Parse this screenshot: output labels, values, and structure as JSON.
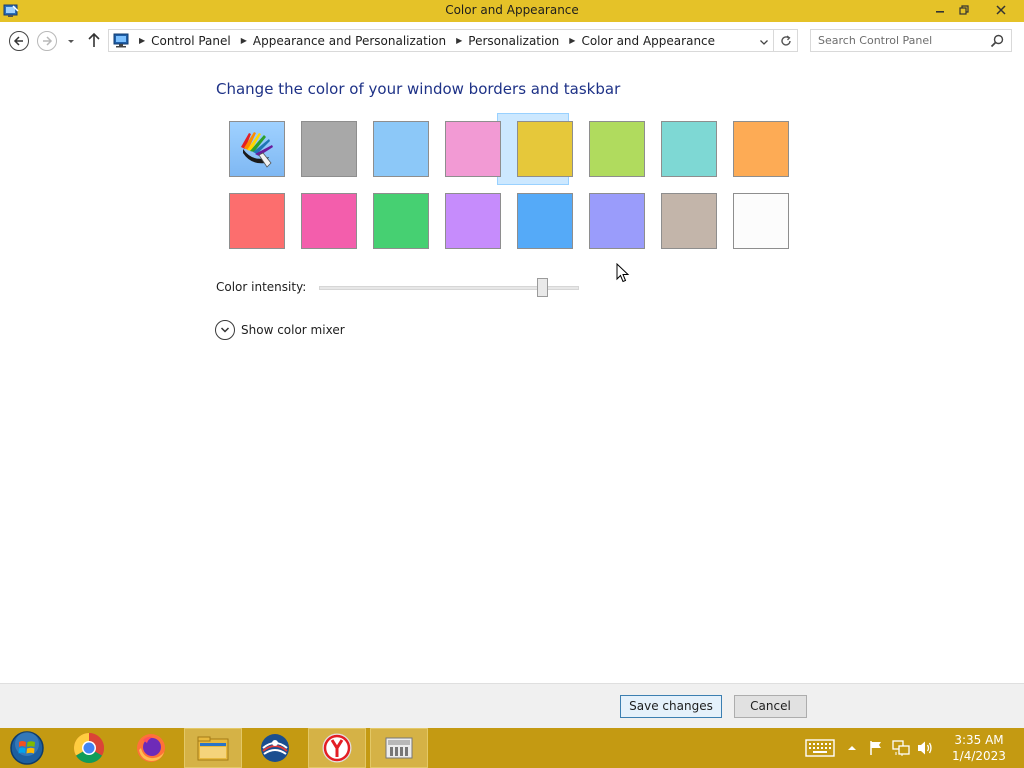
{
  "window": {
    "title": "Color and Appearance",
    "minimize_label": "–",
    "maximize_label": "❐",
    "close_label": "✕"
  },
  "address_bar": {
    "breadcrumbs": [
      "Control Panel",
      "Appearance and Personalization",
      "Personalization",
      "Color and Appearance"
    ],
    "search_placeholder": "Search Control Panel"
  },
  "main": {
    "heading": "Change the color of your window borders and taskbar",
    "selected_swatch_index": 4,
    "swatches": [
      {
        "name": "automatic-palette",
        "color": "#8ec8fb"
      },
      {
        "name": "gray",
        "color": "#a8a8a8"
      },
      {
        "name": "sky-blue",
        "color": "#8cc8f8"
      },
      {
        "name": "pink",
        "color": "#f29ad4"
      },
      {
        "name": "yellow",
        "color": "#e6c83a"
      },
      {
        "name": "lime-green",
        "color": "#b0db5e"
      },
      {
        "name": "teal",
        "color": "#7ed8d4"
      },
      {
        "name": "orange",
        "color": "#fdab55"
      },
      {
        "name": "red",
        "color": "#fc6e6e"
      },
      {
        "name": "magenta",
        "color": "#f35eac"
      },
      {
        "name": "green",
        "color": "#46d072"
      },
      {
        "name": "purple",
        "color": "#c68cfc"
      },
      {
        "name": "blue",
        "color": "#55aaf8"
      },
      {
        "name": "periwinkle",
        "color": "#9a9cfb"
      },
      {
        "name": "taupe",
        "color": "#c3b5aa"
      },
      {
        "name": "white",
        "color": "#fcfcfc"
      }
    ],
    "intensity_label": "Color intensity:",
    "intensity_value": 0.86,
    "color_mixer_label": "Show color mixer"
  },
  "footer": {
    "save_label": "Save changes",
    "cancel_label": "Cancel"
  },
  "taskbar": {
    "pinned": [
      "start-orb",
      "chrome",
      "firefox",
      "file-explorer",
      "opera",
      "yandex",
      "control-panel"
    ],
    "active_app": "control-panel",
    "time": "3:35 AM",
    "date": "1/4/2023"
  },
  "colors": {
    "titlebar": "#e5c228",
    "taskbar": "#c49a12",
    "heading": "#1e3287",
    "selection": "#cce8ff"
  }
}
